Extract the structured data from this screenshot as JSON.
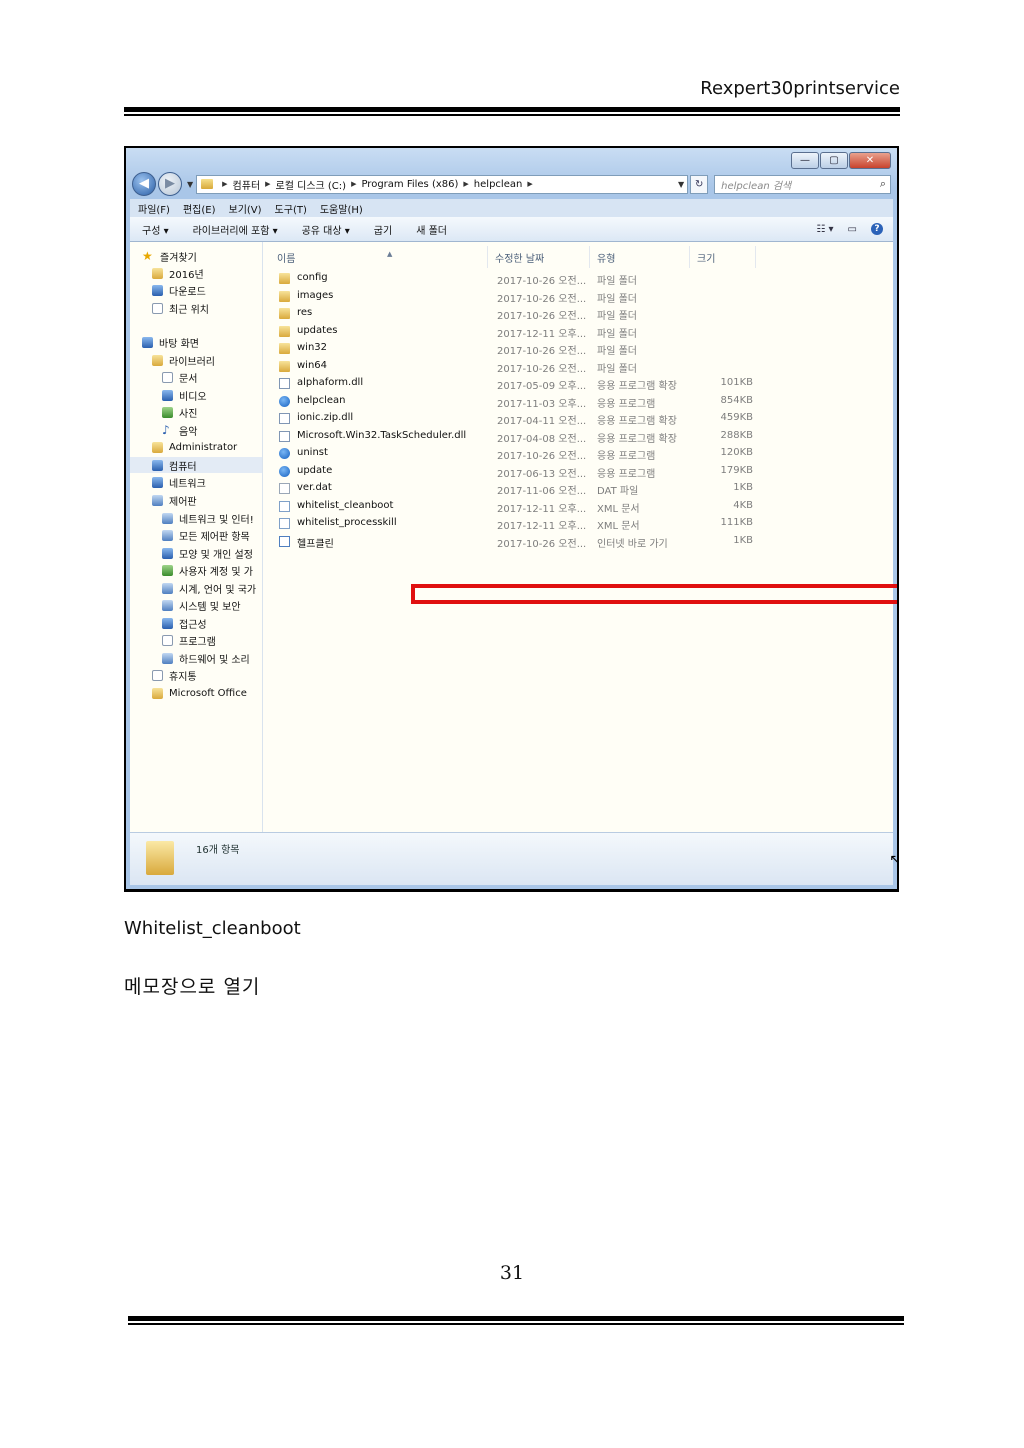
{
  "page": {
    "header_title": "Rexpert30printservice",
    "caption": "Whitelist_cleanboot",
    "caption2": "메모장으로 열기",
    "page_number": "31"
  },
  "window": {
    "controls": {
      "minimize": "—",
      "maximize": "▢",
      "close": "✕"
    },
    "address": {
      "crumbs": [
        "컴퓨터",
        "로컬 디스크 (C:)",
        "Program Files (x86)",
        "helpclean"
      ],
      "search_placeholder": "helpclean 검색"
    },
    "menu": [
      "파일(F)",
      "편집(E)",
      "보기(V)",
      "도구(T)",
      "도움말(H)"
    ],
    "toolbar": {
      "organize": "구성 ▾",
      "include_library": "라이브러리에 포함 ▾",
      "share": "공유 대상 ▾",
      "burn": "굽기",
      "new_folder": "새 폴더"
    },
    "nav": {
      "favorites": "즐겨찾기",
      "fav_items": [
        "2016년",
        "다운로드",
        "최근 위치"
      ],
      "desktop": "바탕 화면",
      "libraries": "라이브러리",
      "lib_items": [
        "문서",
        "비디오",
        "사진",
        "음악"
      ],
      "administrator": "Administrator",
      "computer": "컴퓨터",
      "network": "네트워크",
      "control_panel": "제어판",
      "cp_items": [
        "네트워크 및 인터!",
        "모든 제어판 항목",
        "모양 및 개인 설정",
        "사용자 계정 및 가",
        "시계, 언어 및 국가",
        "시스템 및 보안",
        "접근성",
        "프로그램",
        "하드웨어 및 소리"
      ],
      "recycle": "휴지통",
      "office": "Microsoft Office"
    },
    "columns": {
      "name": "이름",
      "date": "수정한 날짜",
      "type": "유형",
      "size": "크기"
    },
    "files": [
      {
        "name": "config",
        "date": "2017-10-26 오전...",
        "type": "파일 폴더",
        "size": "",
        "icon": "folder"
      },
      {
        "name": "images",
        "date": "2017-10-26 오전...",
        "type": "파일 폴더",
        "size": "",
        "icon": "folder"
      },
      {
        "name": "res",
        "date": "2017-10-26 오전...",
        "type": "파일 폴더",
        "size": "",
        "icon": "folder"
      },
      {
        "name": "updates",
        "date": "2017-12-11 오후...",
        "type": "파일 폴더",
        "size": "",
        "icon": "folder"
      },
      {
        "name": "win32",
        "date": "2017-10-26 오전...",
        "type": "파일 폴더",
        "size": "",
        "icon": "folder"
      },
      {
        "name": "win64",
        "date": "2017-10-26 오전...",
        "type": "파일 폴더",
        "size": "",
        "icon": "folder"
      },
      {
        "name": "alphaform.dll",
        "date": "2017-05-09 오후...",
        "type": "응용 프로그램 확장",
        "size": "101KB",
        "icon": "dll"
      },
      {
        "name": "helpclean",
        "date": "2017-11-03 오후...",
        "type": "응용 프로그램",
        "size": "854KB",
        "icon": "exe"
      },
      {
        "name": "ionic.zip.dll",
        "date": "2017-04-11 오전...",
        "type": "응용 프로그램 확장",
        "size": "459KB",
        "icon": "dll"
      },
      {
        "name": "Microsoft.Win32.TaskScheduler.dll",
        "date": "2017-04-08 오전...",
        "type": "응용 프로그램 확장",
        "size": "288KB",
        "icon": "dll"
      },
      {
        "name": "uninst",
        "date": "2017-10-26 오전...",
        "type": "응용 프로그램",
        "size": "120KB",
        "icon": "exe"
      },
      {
        "name": "update",
        "date": "2017-06-13 오전...",
        "type": "응용 프로그램",
        "size": "179KB",
        "icon": "exe"
      },
      {
        "name": "ver.dat",
        "date": "2017-11-06 오전...",
        "type": "DAT 파일",
        "size": "1KB",
        "icon": "file"
      },
      {
        "name": "whitelist_cleanboot",
        "date": "2017-12-11 오후...",
        "type": "XML 문서",
        "size": "4KB",
        "icon": "xml"
      },
      {
        "name": "whitelist_processkill",
        "date": "2017-12-11 오후...",
        "type": "XML 문서",
        "size": "111KB",
        "icon": "xml"
      },
      {
        "name": "헬프클린",
        "date": "2017-10-26 오전...",
        "type": "인터넷 바로 가기",
        "size": "1KB",
        "icon": "link"
      }
    ],
    "status": "16개 항목"
  }
}
